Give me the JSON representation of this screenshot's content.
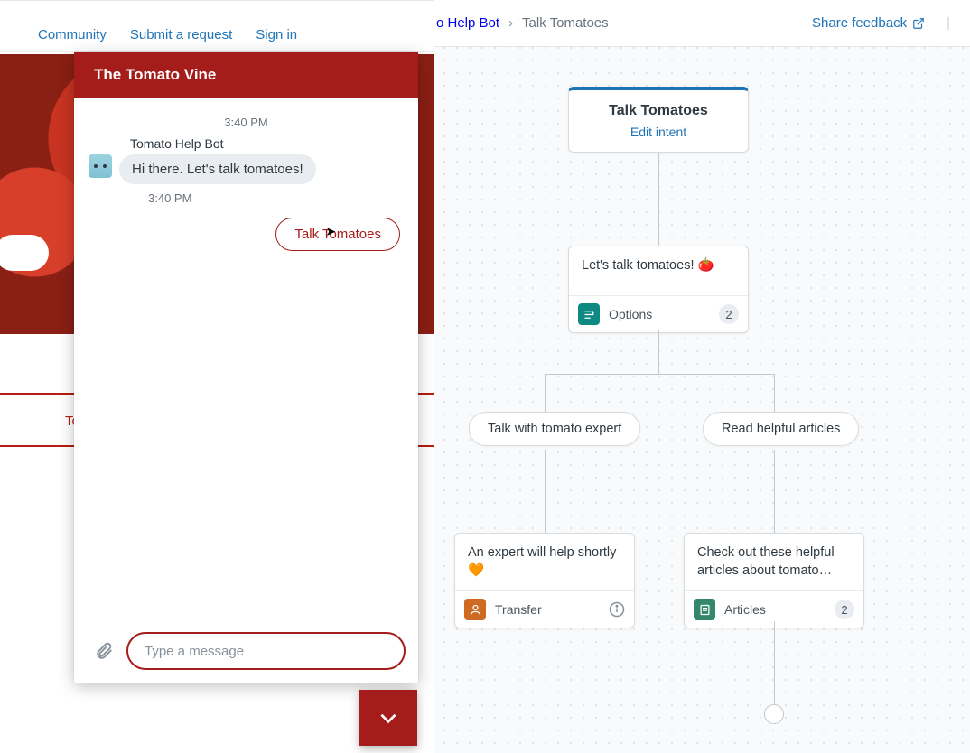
{
  "topnav": {
    "community": "Community",
    "submit": "Submit a request",
    "signin": "Sign in"
  },
  "hero": {
    "tab_peek": "To"
  },
  "chat": {
    "title": "The Tomato Vine",
    "timestamp": "3:40 PM",
    "bot_name": "Tomato Help Bot",
    "greeting": "Hi there. Let's talk tomatoes!",
    "timestamp2": "3:40 PM",
    "quick_reply": "Talk Tomatoes",
    "input_placeholder": "Type a message"
  },
  "builder": {
    "breadcrumb_parent": "o Help Bot",
    "breadcrumb_sep": "›",
    "breadcrumb_current": "Talk Tomatoes",
    "share": "Share feedback",
    "intent": {
      "title": "Talk Tomatoes",
      "edit": "Edit intent"
    },
    "options_step": {
      "text": "Let's talk tomatoes! 🍅",
      "label": "Options",
      "count": "2"
    },
    "option_left": "Talk with tomato expert",
    "option_right": "Read helpful articles",
    "transfer_step": {
      "text": "An expert will help shortly 🧡",
      "label": "Transfer"
    },
    "articles_step": {
      "text": "Check out these helpful articles about tomato…",
      "label": "Articles",
      "count": "2"
    }
  }
}
